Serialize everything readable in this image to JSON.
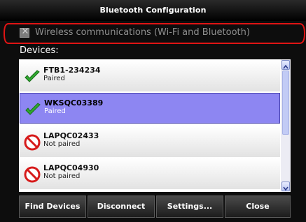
{
  "window": {
    "title": "Bluetooth Configuration"
  },
  "wireless": {
    "label": "Wireless communications (Wi-Fi and Bluetooth)",
    "checked": false,
    "enabled": false
  },
  "devices": {
    "label": "Devices:",
    "items": [
      {
        "name": "FTB1-234234",
        "status": "Paired",
        "icon": "check-icon",
        "selected": false
      },
      {
        "name": "WKSQC03389",
        "status": "Paired",
        "icon": "check-icon",
        "selected": true
      },
      {
        "name": "LAPQC02433",
        "status": "Not paired",
        "icon": "prohibited-icon",
        "selected": false
      },
      {
        "name": "LAPQC04930",
        "status": "Not paired",
        "icon": "prohibited-icon",
        "selected": false
      }
    ]
  },
  "buttons": {
    "find_devices": "Find Devices",
    "disconnect": "Disconnect",
    "settings": "Settings...",
    "close": "Close"
  },
  "colors": {
    "selection": "#8d86f2",
    "highlight_ring": "#e01414",
    "check_green": "#2fa82f",
    "prohibited_red": "#d61a1a"
  }
}
